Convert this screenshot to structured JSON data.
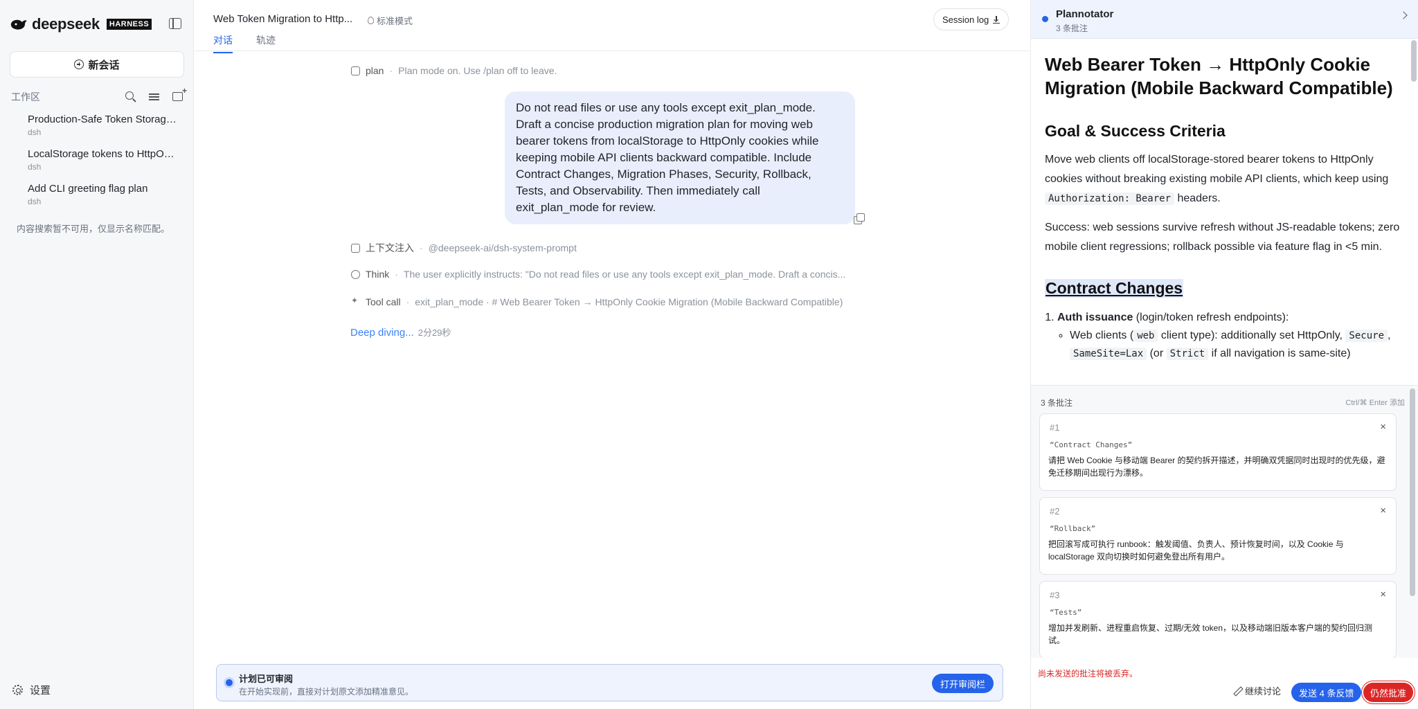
{
  "sidebar": {
    "logo_text": "deepseek",
    "logo_badge": "HARNESS",
    "new_session_label": "新会话",
    "workspace_title": "工作区",
    "sessions": [
      {
        "title": "Production-Safe Token Storage ...",
        "sub": "dsh"
      },
      {
        "title": "LocalStorage tokens to HttpOnl...",
        "sub": "dsh"
      },
      {
        "title": "Add CLI greeting flag plan",
        "sub": "dsh"
      }
    ],
    "search_note": "内容搜索暂不可用，仅显示名称匹配。",
    "settings_label": "设置"
  },
  "main": {
    "title": "Web Token Migration to Http...",
    "mode_label": "标准模式",
    "tabs": [
      "对话",
      "轨迹"
    ],
    "session_log_label": "Session log",
    "plan_row": {
      "label": "plan",
      "detail": "Plan mode on. Use /plan off to leave."
    },
    "user_message": "Do not read files or use any tools except exit_plan_mode. Draft a concise production migration plan for moving web bearer tokens from localStorage to HttpOnly cookies while keeping mobile API clients backward compatible. Include Contract Changes, Migration Phases, Security, Rollback, Tests, and Observability. Then immediately call exit_plan_mode for review.",
    "context_row": {
      "label": "上下文注入",
      "detail": "@deepseek-ai/dsh-system-prompt"
    },
    "think_row": {
      "label": "Think",
      "detail": "The user explicitly instructs: \"Do not read files or use any tools except exit_plan_mode. Draft a concis..."
    },
    "tool_row": {
      "label": "Tool call",
      "detail": "exit_plan_mode · # Web Bearer Token → HttpOnly Cookie Migration (Mobile Backward Compatible)"
    },
    "deep_diving": "Deep diving...",
    "deep_time": "2分29秒",
    "review_bar": {
      "title": "计划已可审阅",
      "sub": "在开始实现前，直接对计划原文添加精准意见。",
      "button": "打开审阅栏"
    }
  },
  "panel": {
    "title": "Plannotator",
    "sub": "3 条批注",
    "doc": {
      "h1": "Web Bearer Token → HttpOnly Cookie Migration (Mobile Backward Compatible)",
      "h2_goal": "Goal & Success Criteria",
      "p1_a": "Move web clients off localStorage-stored bearer tokens to HttpOnly cookies without breaking existing mobile API clients, which keep using ",
      "p1_code": "Authorization: Bearer",
      "p1_b": " headers.",
      "p2": "Success: web sessions survive refresh without JS-readable tokens; zero mobile client regressions; rollback possible via feature flag in <5 min.",
      "h2_contract": "Contract Changes",
      "li1_bold": "Auth issuance",
      "li1_rest": " (login/token refresh endpoints):",
      "sub_a": "Web clients (",
      "sub_code1": "web",
      "sub_b": " client type): additionally set HttpOnly, ",
      "sub_code2": "Secure",
      "sub_code3": "SameSite=Lax",
      "sub_c": " (or ",
      "sub_code4": "Strict",
      "sub_d": " if all navigation is same-site)"
    },
    "annotations_head": "3 条批注",
    "annotations_hint": "Ctrl/⌘ Enter 添加",
    "annotations": [
      {
        "num": "#1",
        "quote": "“Contract Changes”",
        "text": "请把 Web Cookie 与移动端 Bearer 的契约拆开描述，并明确双凭据同时出现时的优先级，避免迁移期间出现行为漂移。"
      },
      {
        "num": "#2",
        "quote": "“Rollback”",
        "text": "把回滚写成可执行 runbook：触发阈值、负责人、预计恢复时间，以及 Cookie 与 localStorage 双向切换时如何避免登出所有用户。"
      },
      {
        "num": "#3",
        "quote": "“Tests”",
        "text": "增加并发刷新、进程重启恢复、过期/无效 token，以及移动端旧版本客户端的契约回归测试。"
      }
    ],
    "close_glyph": "×",
    "warning": "尚未发送的批注将被丢弃。",
    "continue_label": "继续讨论",
    "send_label": "发送 4 条反馈",
    "approve_label": "仍然批准"
  },
  "colors": {
    "accent": "#2563eb",
    "danger": "#dc2626",
    "bubble": "#e9eefc"
  }
}
